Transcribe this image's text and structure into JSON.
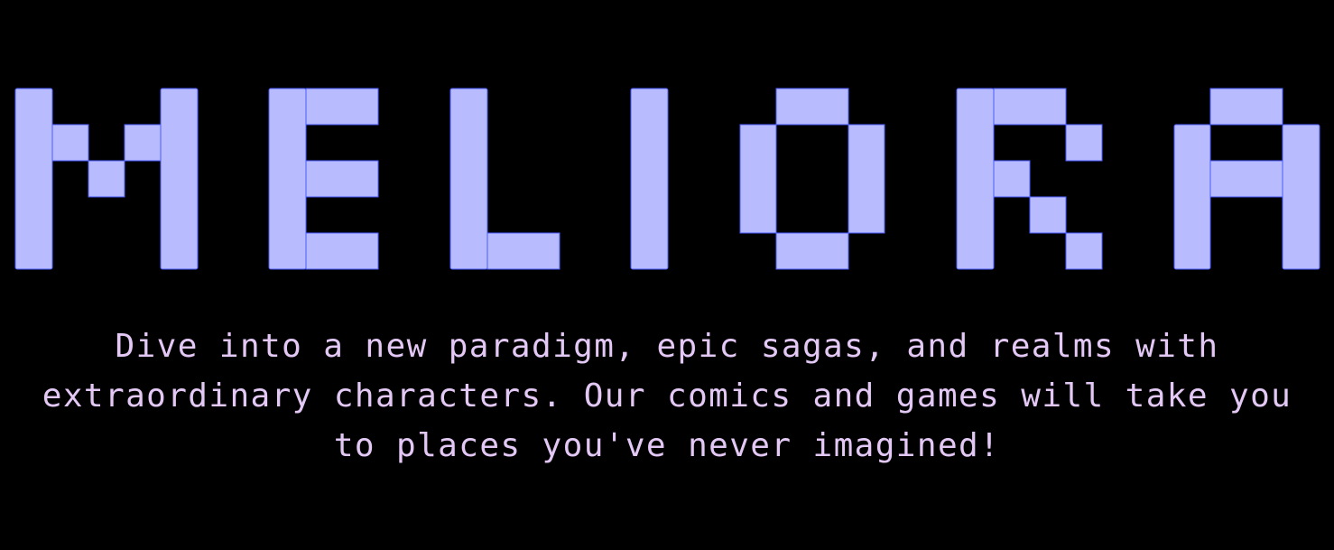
{
  "hero": {
    "title": "MELIORA",
    "tagline_lines": [
      "Dive into a new paradigm, epic sagas, and realms with",
      "extraordinary characters. Our comics and games will take you",
      "to places you've never imagined!"
    ]
  },
  "colors": {
    "background": "#000000",
    "title_fill": "#b8bcff",
    "title_outline": "#4a5dff",
    "tagline": "#e3c8f5"
  }
}
